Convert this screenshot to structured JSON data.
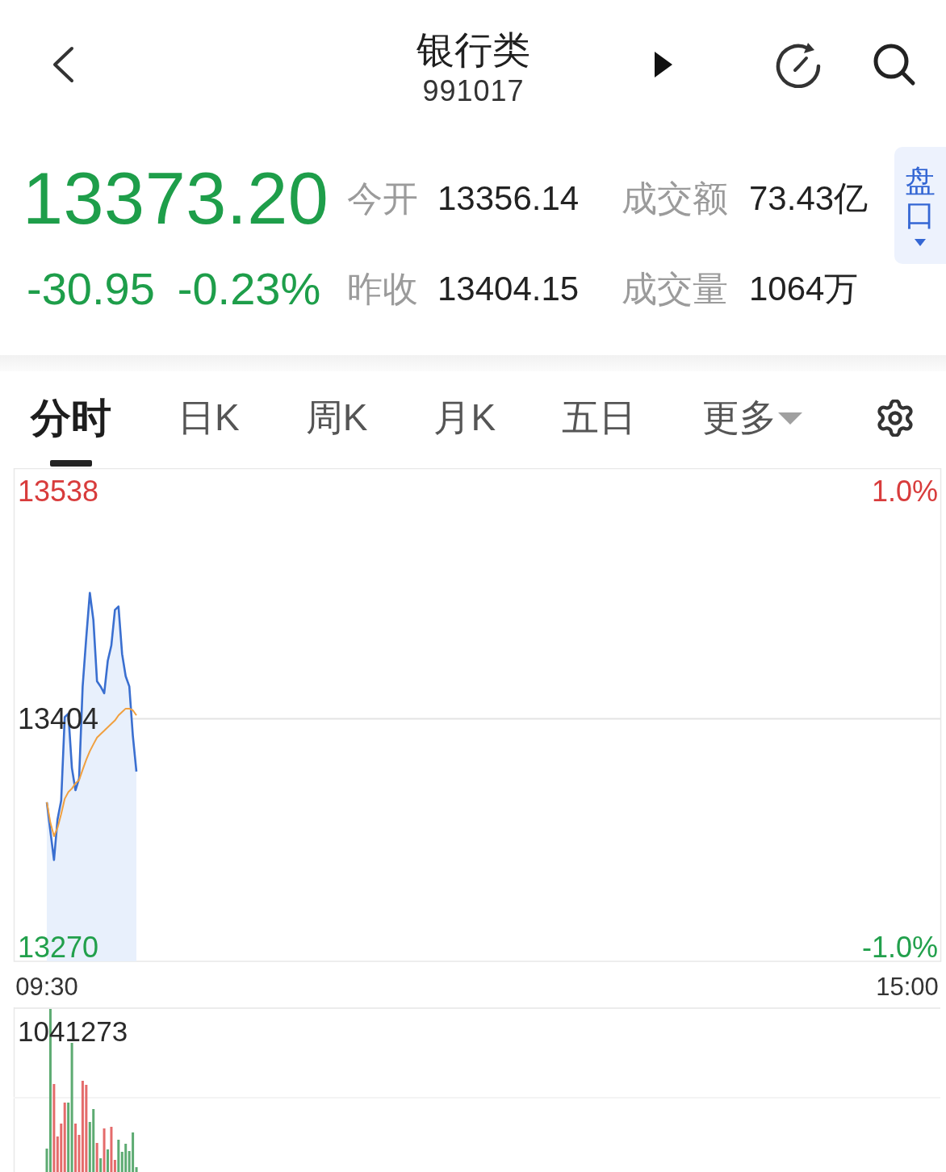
{
  "header": {
    "title": "银行类",
    "code": "991017"
  },
  "quote": {
    "falling": true,
    "price": "13373.20",
    "change": "-30.95",
    "change_percent": "-0.23%",
    "stats": [
      {
        "label": "今开",
        "value": "13356.14"
      },
      {
        "label": "成交额",
        "value": "73.43亿"
      },
      {
        "label": "昨收",
        "value": "13404.15"
      },
      {
        "label": "成交量",
        "value": "1064万"
      }
    ]
  },
  "side_tab": {
    "label": "盘口"
  },
  "tabs": [
    {
      "label": "分时",
      "selected": true,
      "kind": "tab"
    },
    {
      "label": "日K",
      "selected": false,
      "kind": "tab"
    },
    {
      "label": "周K",
      "selected": false,
      "kind": "tab"
    },
    {
      "label": "月K",
      "selected": false,
      "kind": "tab"
    },
    {
      "label": "五日",
      "selected": false,
      "kind": "tab"
    },
    {
      "label": "更多",
      "selected": false,
      "kind": "menu"
    }
  ],
  "chart": {
    "chart_data": {
      "type": "line",
      "categories": [
        "09:30",
        null,
        null,
        null,
        null,
        null,
        null,
        null,
        null,
        null,
        null,
        null,
        null,
        null,
        null,
        null,
        null,
        null,
        null,
        null,
        null,
        null,
        null,
        null,
        null,
        null,
        null,
        null,
        null,
        null,
        null,
        null,
        null,
        null,
        null,
        null,
        null,
        null,
        null,
        null,
        null,
        null,
        null,
        null,
        null,
        null,
        null,
        null,
        null,
        null,
        null,
        null,
        null,
        null,
        null,
        null,
        null,
        null,
        null,
        null,
        null,
        null,
        null,
        null,
        null,
        null,
        null,
        null,
        null,
        null,
        null,
        null,
        null,
        null,
        null,
        null,
        null,
        null,
        null,
        null,
        null,
        null,
        null,
        null,
        null,
        null,
        null,
        null,
        null,
        null,
        null,
        null,
        null,
        null,
        null,
        null,
        null,
        null,
        null,
        null,
        null,
        null,
        null,
        null,
        null,
        null,
        null,
        null,
        null,
        null,
        null,
        null,
        null,
        null,
        null,
        null,
        null,
        null,
        null,
        null,
        null,
        null,
        null,
        null,
        null,
        null,
        null,
        null,
        null,
        null,
        null,
        null,
        null,
        null,
        null,
        null,
        null,
        null,
        null,
        null,
        null,
        null,
        null,
        null,
        null,
        null,
        null,
        null,
        null,
        null,
        null,
        null,
        null,
        null,
        null,
        null,
        null,
        null,
        null,
        null,
        null,
        null,
        null,
        null,
        null,
        null,
        null,
        null,
        null,
        null,
        null,
        null,
        null,
        null,
        null,
        null,
        null,
        null,
        null,
        null,
        null,
        null,
        null,
        null,
        null,
        null,
        null,
        null,
        null,
        null,
        null,
        null,
        null,
        null,
        null,
        null,
        null,
        null,
        null,
        null,
        null,
        null,
        null,
        null,
        null,
        null,
        null,
        null,
        null,
        null,
        null,
        null,
        null,
        null,
        null,
        null,
        null,
        null,
        null,
        null,
        null,
        null,
        null,
        null,
        null,
        null,
        null,
        null,
        null,
        null,
        null,
        null,
        null,
        null,
        null,
        null,
        null,
        null,
        null,
        null,
        "15:00"
      ],
      "series": [
        {
          "color": "#3a6fd0",
          "values": [
            13355,
            13338,
            13321,
            13345,
            13356,
            13405,
            13407,
            13375,
            13362,
            13369,
            13423,
            13452,
            13478,
            13462,
            13426,
            13423,
            13419,
            13438,
            13447,
            13468,
            13470,
            13442,
            13429,
            13423,
            13394,
            13373,
            null,
            null,
            null,
            null,
            null,
            null,
            null,
            null,
            null,
            null,
            null,
            null,
            null,
            null,
            null,
            null,
            null,
            null,
            null,
            null,
            null,
            null,
            null,
            null,
            null,
            null,
            null,
            null,
            null,
            null,
            null,
            null,
            null,
            null,
            null,
            null,
            null,
            null,
            null,
            null,
            null,
            null,
            null,
            null,
            null,
            null,
            null,
            null,
            null,
            null,
            null,
            null,
            null,
            null,
            null,
            null,
            null,
            null,
            null,
            null,
            null,
            null,
            null,
            null,
            null,
            null,
            null,
            null,
            null,
            null,
            null,
            null,
            null,
            null,
            null,
            null,
            null,
            null,
            null,
            null,
            null,
            null,
            null,
            null,
            null,
            null,
            null,
            null,
            null,
            null,
            null,
            null,
            null,
            null,
            null,
            null,
            null,
            null,
            null,
            null,
            null,
            null,
            null,
            null,
            null,
            null,
            null,
            null,
            null,
            null,
            null,
            null,
            null,
            null,
            null,
            null,
            null,
            null,
            null,
            null,
            null,
            null,
            null,
            null,
            null,
            null,
            null,
            null,
            null,
            null,
            null,
            null,
            null,
            null,
            null,
            null,
            null,
            null,
            null,
            null,
            null,
            null,
            null,
            null,
            null,
            null,
            null,
            null,
            null,
            null,
            null,
            null,
            null,
            null,
            null,
            null,
            null,
            null,
            null,
            null,
            null,
            null,
            null,
            null,
            null,
            null,
            null,
            null,
            null,
            null,
            null,
            null,
            null,
            null,
            null,
            null,
            null,
            null,
            null,
            null,
            null,
            null,
            null,
            null,
            null,
            null,
            null,
            null,
            null,
            null,
            null,
            null,
            null,
            null,
            null,
            null,
            null,
            null,
            null,
            null,
            null,
            null,
            null,
            null,
            null,
            null,
            null,
            null,
            null,
            null,
            null,
            null,
            null,
            null,
            null
          ]
        },
        {
          "color": "#f0a040",
          "values": [
            13355,
            13343,
            13335,
            13340,
            13348,
            13357,
            13361,
            13363,
            13366,
            13368,
            13374,
            13380,
            13385,
            13389,
            13393,
            13395,
            13397,
            13399,
            13401,
            13403,
            13406,
            13408,
            13410,
            13410,
            13409,
            13406,
            null,
            null,
            null,
            null,
            null,
            null,
            null,
            null,
            null,
            null,
            null,
            null,
            null,
            null,
            null,
            null,
            null,
            null,
            null,
            null,
            null,
            null,
            null,
            null,
            null,
            null,
            null,
            null,
            null,
            null,
            null,
            null,
            null,
            null,
            null,
            null,
            null,
            null,
            null,
            null,
            null,
            null,
            null,
            null,
            null,
            null,
            null,
            null,
            null,
            null,
            null,
            null,
            null,
            null,
            null,
            null,
            null,
            null,
            null,
            null,
            null,
            null,
            null,
            null,
            null,
            null,
            null,
            null,
            null,
            null,
            null,
            null,
            null,
            null,
            null,
            null,
            null,
            null,
            null,
            null,
            null,
            null,
            null,
            null,
            null,
            null,
            null,
            null,
            null,
            null,
            null,
            null,
            null,
            null,
            null,
            null,
            null,
            null,
            null,
            null,
            null,
            null,
            null,
            null,
            null,
            null,
            null,
            null,
            null,
            null,
            null,
            null,
            null,
            null,
            null,
            null,
            null,
            null,
            null,
            null,
            null,
            null,
            null,
            null,
            null,
            null,
            null,
            null,
            null,
            null,
            null,
            null,
            null,
            null,
            null,
            null,
            null,
            null,
            null,
            null,
            null,
            null,
            null,
            null,
            null,
            null,
            null,
            null,
            null,
            null,
            null,
            null,
            null,
            null,
            null,
            null,
            null,
            null,
            null,
            null,
            null,
            null,
            null,
            null,
            null,
            null,
            null,
            null,
            null,
            null,
            null,
            null,
            null,
            null,
            null,
            null,
            null,
            null,
            null,
            null,
            null,
            null,
            null,
            null,
            null,
            null,
            null,
            null,
            null,
            null,
            null,
            null,
            null,
            null,
            null,
            null,
            null,
            null,
            null,
            null,
            null,
            null,
            null,
            null,
            null,
            null,
            null,
            null,
            null,
            null,
            null,
            null,
            null,
            null,
            null
          ]
        }
      ],
      "ylim": [
        13270,
        13538
      ],
      "yticks": [
        {
          "value": 13538,
          "label": "13538"
        },
        {
          "value": 13404,
          "label": "13404"
        },
        {
          "value": 13270,
          "label": "13270"
        }
      ]
    },
    "percent_ticks": [
      "1.0%",
      "-1.0%"
    ]
  },
  "volume": {
    "max_label": "1041273"
  }
}
